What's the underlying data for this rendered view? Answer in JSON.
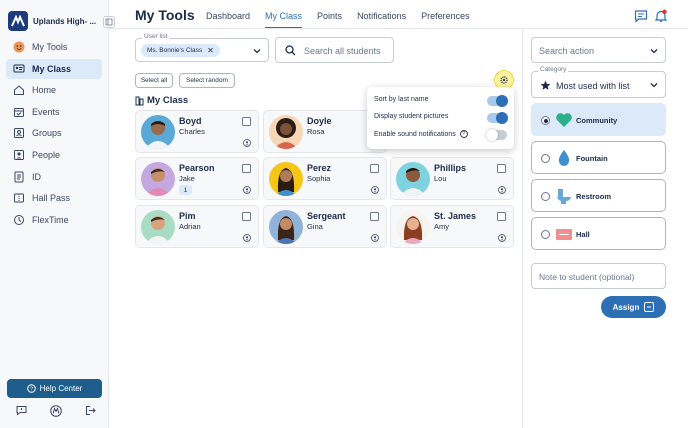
{
  "sidebar": {
    "school_name": "Uplands High- ...",
    "items": [
      {
        "label": "My Tools",
        "icon": "smiley-avatar-icon"
      },
      {
        "label": "My Class",
        "icon": "class-icon",
        "active": true
      },
      {
        "label": "Home",
        "icon": "home-icon"
      },
      {
        "label": "Events",
        "icon": "calendar-icon"
      },
      {
        "label": "Groups",
        "icon": "groups-icon"
      },
      {
        "label": "People",
        "icon": "person-card-icon"
      },
      {
        "label": "ID",
        "icon": "id-card-icon"
      },
      {
        "label": "Hall Pass",
        "icon": "hall-pass-icon"
      },
      {
        "label": "FlexTime",
        "icon": "flextime-icon"
      }
    ],
    "help_label": "Help Center"
  },
  "header": {
    "title": "My Tools",
    "tabs": [
      {
        "label": "Dashboard"
      },
      {
        "label": "My Class",
        "active": true
      },
      {
        "label": "Points"
      },
      {
        "label": "Notifications"
      },
      {
        "label": "Preferences"
      }
    ]
  },
  "filters": {
    "user_list_label": "User list",
    "user_list_chip": "Ms. Bonnie's Class",
    "search_placeholder": "Search all students",
    "select_all": "Select all",
    "select_random": "Select random"
  },
  "section_title": "My Class",
  "students": [
    {
      "last": "Boyd",
      "first": "Charles"
    },
    {
      "last": "Doyle",
      "first": "Rosa"
    },
    {
      "last": "Pearson",
      "first": "Jake",
      "badge": "1"
    },
    {
      "last": "Perez",
      "first": "Sophia"
    },
    {
      "last": "Phillips",
      "first": "Lou"
    },
    {
      "last": "Pim",
      "first": "Adrian"
    },
    {
      "last": "Sergeant",
      "first": "Gina"
    },
    {
      "last": "St. James",
      "first": "Amy"
    }
  ],
  "settings_popover": {
    "items": [
      {
        "label": "Sort by last name",
        "on": true
      },
      {
        "label": "Display student pictures",
        "on": true
      },
      {
        "label": "Enable sound notifications",
        "on": false,
        "help": "?"
      }
    ]
  },
  "right_panel": {
    "action_search_placeholder": "Search action",
    "category_label": "Category",
    "category_value": "Most used with list",
    "passes": [
      {
        "label": "Community",
        "selected": true,
        "icon": "heart-icon"
      },
      {
        "label": "Fountain",
        "selected": false,
        "icon": "water-drop-icon"
      },
      {
        "label": "Restroom",
        "selected": false,
        "icon": "toilet-icon"
      },
      {
        "label": "Hall",
        "selected": false,
        "icon": "hall-sign-icon"
      }
    ],
    "note_placeholder": "Note to student (optional)",
    "assign_label": "Assign"
  },
  "colors": {
    "accent": "#2c6fb5",
    "selected_bg": "#dbe9f9",
    "sidebar_bg": "#f7f8fa",
    "help_bg": "#1e5e8c",
    "heart": "#2bb08a",
    "drop": "#3d8fd1",
    "restroom": "#6aa6d8",
    "hall": "#f28d8d"
  }
}
